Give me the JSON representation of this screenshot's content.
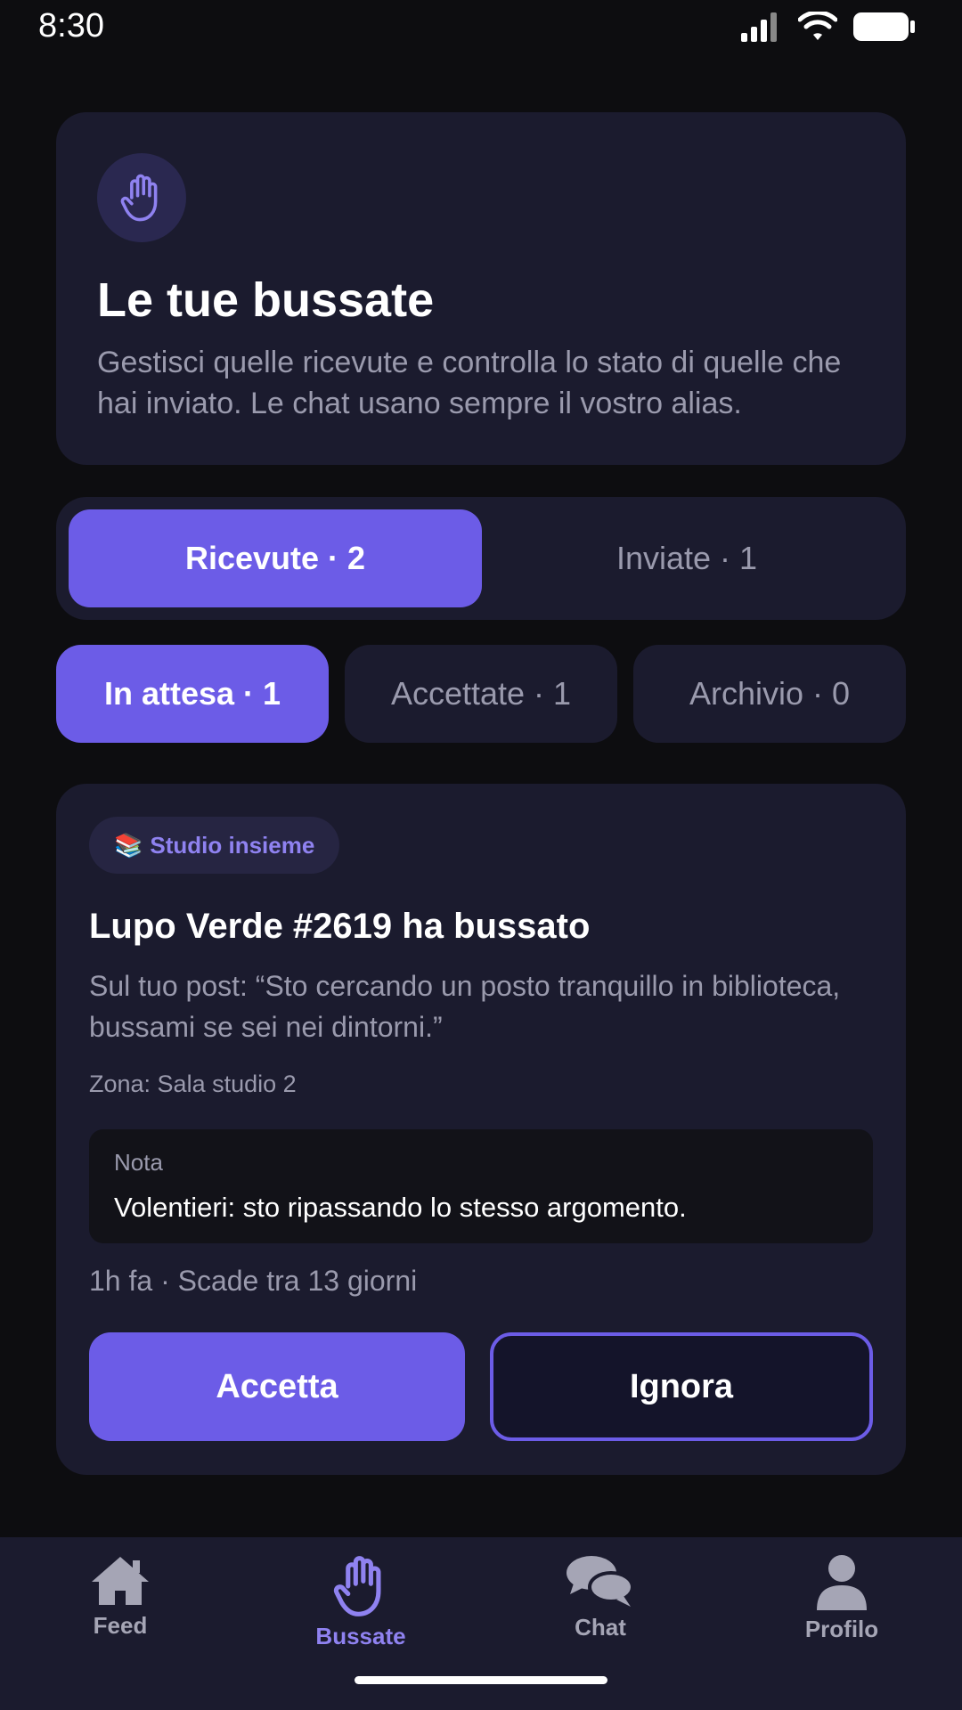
{
  "status_bar": {
    "time": "8:30"
  },
  "header": {
    "title": "Le tue bussate",
    "subtitle": "Gestisci quelle ricevute e controlla lo stato di quelle che hai inviato. Le chat usano sempre il vostro alias."
  },
  "main_tabs": [
    {
      "label": "Ricevute · 2",
      "active": true
    },
    {
      "label": "Inviate · 1",
      "active": false
    }
  ],
  "filters": [
    {
      "label": "In attesa · 1",
      "active": true
    },
    {
      "label": "Accettate · 1",
      "active": false
    },
    {
      "label": "Archivio · 0",
      "active": false
    }
  ],
  "knock": {
    "tag_emoji": "📚",
    "tag_label": "Studio insieme",
    "title": "Lupo Verde #2619 ha bussato",
    "post": "Sul tuo post: “Sto cercando un posto tranquillo in biblioteca, bussami se sei nei dintorni.”",
    "zone": "Zona: Sala studio 2",
    "note_label": "Nota",
    "note_text": "Volentieri: sto ripassando lo stesso argomento.",
    "meta": "1h fa · Scade tra 13 giorni",
    "accept_label": "Accetta",
    "ignore_label": "Ignora"
  },
  "nav": [
    {
      "label": "Feed",
      "icon": "home-icon",
      "active": false
    },
    {
      "label": "Bussate",
      "icon": "hand-icon",
      "active": true
    },
    {
      "label": "Chat",
      "icon": "chat-icon",
      "active": false
    },
    {
      "label": "Profilo",
      "icon": "profile-icon",
      "active": false
    }
  ],
  "colors": {
    "accent": "#6c5ce7",
    "accent_text": "#8f82f0",
    "card": "#1b1b2e",
    "background": "#0d0d10",
    "muted_text": "#9a9aad"
  }
}
